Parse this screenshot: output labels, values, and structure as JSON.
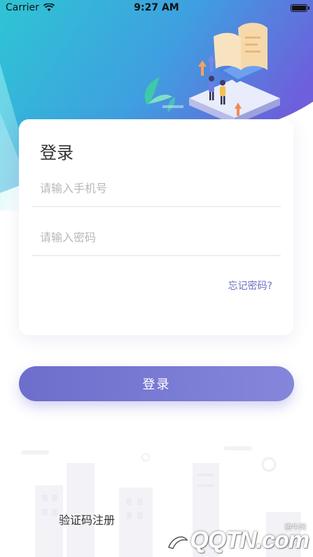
{
  "status_bar": {
    "carrier": "Carrier",
    "time": "9:27 AM",
    "battery_level": 1.0
  },
  "hero": {
    "illustration": "business-people-data-illustration",
    "colors": {
      "gradient_start": "#27c6d6",
      "gradient_end": "#6c63e0"
    }
  },
  "login_card": {
    "title": "登录",
    "phone_placeholder": "请输入手机号",
    "password_placeholder": "请输入密码",
    "forgot_password": "忘记密码?"
  },
  "login_button": {
    "label": "登录"
  },
  "register": {
    "label": "验证码注册"
  },
  "watermark": {
    "logo_text": "QQTN.com",
    "small_text": "腾牛网"
  }
}
